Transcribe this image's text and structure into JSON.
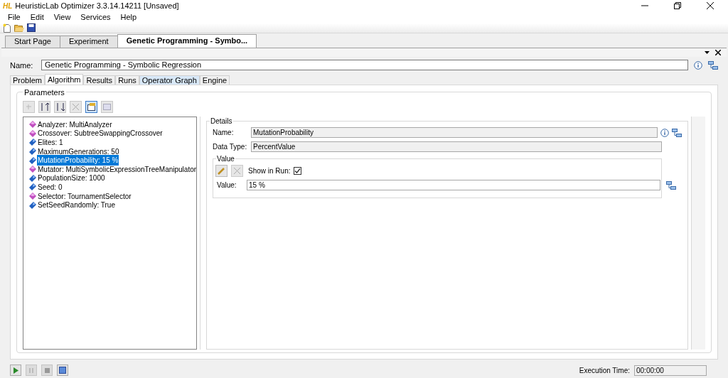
{
  "window": {
    "logo": "HL",
    "title": "HeuristicLab Optimizer 3.3.14.14211 [Unsaved]"
  },
  "menu": [
    "File",
    "Edit",
    "View",
    "Services",
    "Help"
  ],
  "document_tabs": [
    {
      "label": "Start Page",
      "selected": false
    },
    {
      "label": "Experiment",
      "selected": false
    },
    {
      "label": "Genetic Programming - Symbo...",
      "selected": true
    }
  ],
  "name": {
    "label": "Name:",
    "value": "Genetic Programming - Symbolic Regression"
  },
  "view_tabs": [
    {
      "label": "Problem",
      "selected": false
    },
    {
      "label": "Algorithm",
      "selected": true
    },
    {
      "label": "Results",
      "selected": false
    },
    {
      "label": "Runs",
      "selected": false
    },
    {
      "label": "Operator Graph",
      "selected": false,
      "highlighted": true
    },
    {
      "label": "Engine",
      "selected": false
    }
  ],
  "parameters": {
    "title": "Parameters",
    "items": [
      {
        "kind": "operator",
        "label": "Analyzer: MultiAnalyzer",
        "selected": false
      },
      {
        "kind": "operator",
        "label": "Crossover: SubtreeSwappingCrossover",
        "selected": false
      },
      {
        "kind": "value",
        "label": "Elites: 1",
        "selected": false
      },
      {
        "kind": "value",
        "label": "MaximumGenerations: 50",
        "selected": false
      },
      {
        "kind": "value",
        "label": "MutationProbability: 15 %",
        "selected": true
      },
      {
        "kind": "operator",
        "label": "Mutator: MultiSymbolicExpressionTreeManipulator",
        "selected": false
      },
      {
        "kind": "value",
        "label": "PopulationSize: 1000",
        "selected": false
      },
      {
        "kind": "value",
        "label": "Seed: 0",
        "selected": false
      },
      {
        "kind": "operator",
        "label": "Selector: TournamentSelector",
        "selected": false
      },
      {
        "kind": "value",
        "label": "SetSeedRandomly: True",
        "selected": false
      }
    ]
  },
  "details": {
    "title": "Details",
    "name_label": "Name:",
    "name_value": "MutationProbability",
    "type_label": "Data Type:",
    "type_value": "PercentValue",
    "value_group": {
      "title": "Value",
      "show_in_run_label": "Show in Run:",
      "show_in_run_checked": true,
      "value_label": "Value:",
      "value": "15 %"
    }
  },
  "status": {
    "execution_time_label": "Execution Time:",
    "execution_time": "00:00:00"
  }
}
